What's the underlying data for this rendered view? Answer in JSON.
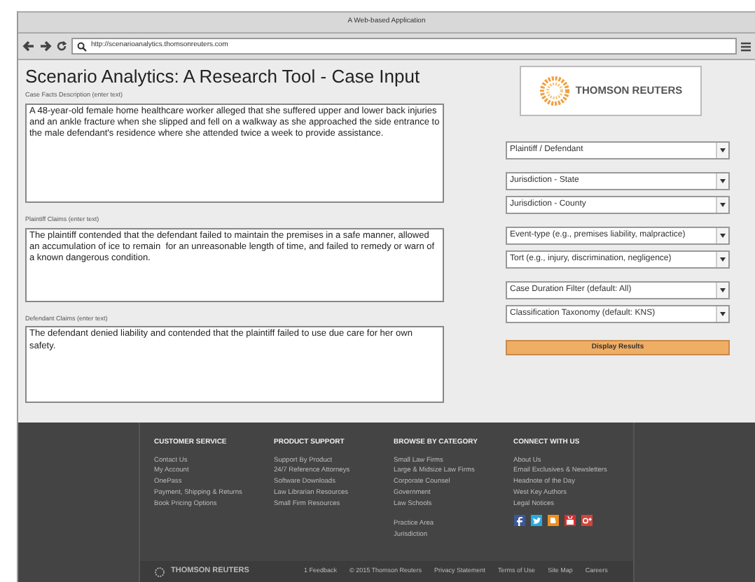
{
  "window": {
    "title": "A Web-based Application"
  },
  "browser": {
    "url": "http://scenarioanalytics.thomsonreuters.com"
  },
  "page": {
    "title": "Scenario Analytics:  A Research Tool - Case Input",
    "fields": [
      {
        "label": "Case Facts Description (enter text)",
        "value": "A 48-year-old female home healthcare worker alleged that she suffered upper and lower back injuries and an ankle fracture when she slipped and fell on a walkway as she approached the side entrance to the male defendant's residence where she attended twice a week to provide assistance."
      },
      {
        "label": "Plaintiff Claims (enter text)",
        "value": "The plaintiff contended that the defendant failed to maintain the premises in a safe manner, allowed an accumulation of ice to remain  for an unreasonable length of time, and failed to remedy or warn of a known dangerous condition."
      },
      {
        "label": "Defendant Claims (enter text)",
        "value": "The defendant denied liability and contended that the plaintiff failed to use due care for her own safety."
      }
    ],
    "logo": {
      "text": "THOMSON REUTERS"
    },
    "dropdown_groups": [
      [
        "Plaintiff / Defendant"
      ],
      [
        "Jurisdiction - State",
        "Jurisdiction - County"
      ],
      [
        "Event-type (e.g., premises liability, malpractice)",
        "Tort (e.g., injury, discrimination, negligence)"
      ],
      [
        "Case Duration Filter (default: All)",
        "Classification Taxonomy (default: KNS)"
      ]
    ],
    "button": "Display Results"
  },
  "footer": {
    "columns": [
      {
        "heading": "CUSTOMER SERVICE",
        "links": [
          "Contact Us",
          "My Account",
          "OnePass",
          "Payment, Shipping & Returns",
          "Book Pricing Options"
        ]
      },
      {
        "heading": "PRODUCT SUPPORT",
        "links": [
          "Support By Product",
          "24/7 Reference Attorneys",
          "Software Downloads",
          "Law Librarian Resources",
          "Small Firm Resources"
        ]
      },
      {
        "heading": "BROWSE BY CATEGORY",
        "links": [
          "Small Law Firms",
          "Large & Midsize Law Firms",
          "Corporate Counsel",
          "Government",
          "Law Schools"
        ],
        "more_links": [
          "Practice Area",
          "Jurisdiction"
        ]
      },
      {
        "heading": "CONNECT WITH US",
        "links": [
          "About Us",
          "Email Exclusives & Newsletters",
          "Headnote of the Day",
          "West Key Authors",
          "Legal Notices"
        ],
        "social": [
          {
            "kind": "facebook",
            "color": "#3b5998"
          },
          {
            "kind": "twitter",
            "color": "#2aa9e0"
          },
          {
            "kind": "blogger",
            "color": "#f0901e"
          },
          {
            "kind": "youtube",
            "color": "#d62f2f"
          },
          {
            "kind": "googleplus",
            "color": "#d0453a"
          }
        ]
      }
    ],
    "brand": "THOMSON REUTERS",
    "bottom_links": [
      "1 Feedback",
      "© 2015 Thomson Reuters",
      "Privacy Statement",
      "Terms of Use",
      "Site Map",
      "Careers"
    ]
  }
}
